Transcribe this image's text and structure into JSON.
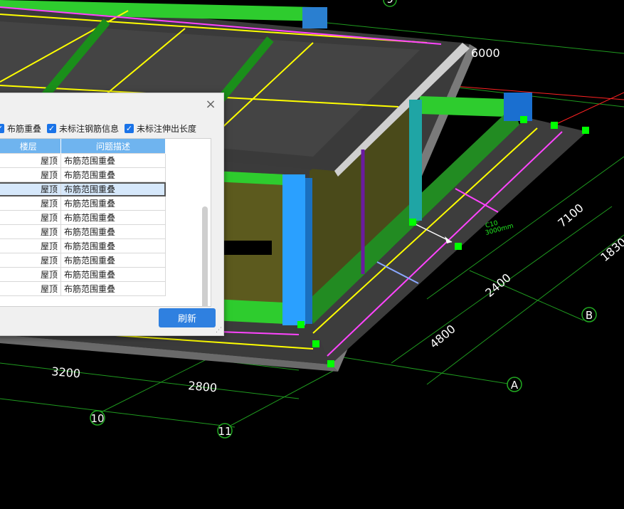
{
  "colors": {
    "background": "#000000",
    "slab": "#3a3a3a",
    "beam_green": "#2ecc2e",
    "column_blue": "#2aa0ff",
    "wall_olive": "#4a4a20",
    "rebar_yellow": "#ffff00",
    "rebar_magenta": "#ff40ff",
    "grid_line": "#22aa22",
    "accent_button": "#2f80e0",
    "header_blue": "#6fb4ef"
  },
  "dimensions": {
    "d6000": "6000",
    "d7100": "7100",
    "d18300": "1830",
    "d2400": "2400",
    "d4800": "4800",
    "d3200": "3200",
    "d2800": "2800"
  },
  "axes": {
    "a10": "10",
    "a11": "11",
    "aA": "A",
    "aB": "B",
    "a9": "9"
  },
  "annotation": {
    "line1": "C10",
    "line2": "3000mm"
  },
  "dialog": {
    "close": "×",
    "options": [
      {
        "label": "布筋重叠",
        "checked": true
      },
      {
        "label": "未标注钢筋信息",
        "checked": true
      },
      {
        "label": "未标注伸出长度",
        "checked": true
      }
    ],
    "columns": [
      "楼层",
      "问题描述"
    ],
    "rows": [
      {
        "floor": "屋顶",
        "issue": "布筋范围重叠"
      },
      {
        "floor": "屋顶",
        "issue": "布筋范围重叠"
      },
      {
        "floor": "屋顶",
        "issue": "布筋范围重叠",
        "selected": true
      },
      {
        "floor": "屋顶",
        "issue": "布筋范围重叠"
      },
      {
        "floor": "屋顶",
        "issue": "布筋范围重叠"
      },
      {
        "floor": "屋顶",
        "issue": "布筋范围重叠"
      },
      {
        "floor": "屋顶",
        "issue": "布筋范围重叠"
      },
      {
        "floor": "屋顶",
        "issue": "布筋范围重叠"
      },
      {
        "floor": "屋顶",
        "issue": "布筋范围重叠"
      },
      {
        "floor": "屋顶",
        "issue": "布筋范围重叠"
      }
    ],
    "refresh": "刷新"
  }
}
